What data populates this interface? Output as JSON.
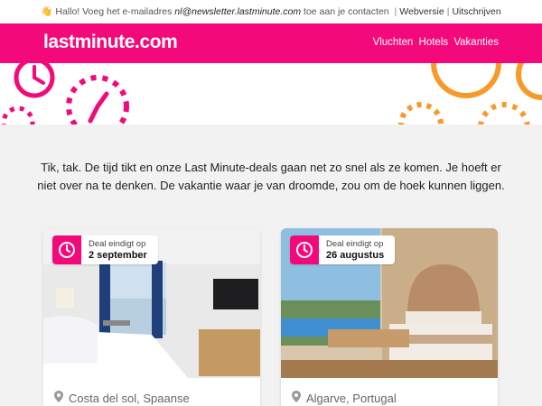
{
  "preheader": {
    "hello": "Hallo! Voeg het e-mailadres",
    "email": "nl@newsletter.lastminute.com",
    "suffix": "toe aan je contacten",
    "sep": "|",
    "webversion": "Webversie",
    "unsubscribe": "Uitschrijven"
  },
  "header": {
    "logo": "lastminute.com",
    "nav": [
      "Vluchten",
      "Hotels",
      "Vakanties"
    ]
  },
  "intro": "Tik, tak. De tijd tikt en onze Last Minute-deals gaan net zo snel als ze komen. Je hoeft er niet over na te denken. De vakantie waar je van droomde, zou om de hoek kunnen liggen.",
  "deals": [
    {
      "badge_label": "Deal eindigt op",
      "end_date": "2 september",
      "location": "Costa del sol, Spaanse"
    },
    {
      "badge_label": "Deal eindigt op",
      "end_date": "26 augustus",
      "location": "Algarve, Portugal"
    }
  ],
  "colors": {
    "brand": "#f4097b",
    "accent_orange": "#f79a2a"
  }
}
